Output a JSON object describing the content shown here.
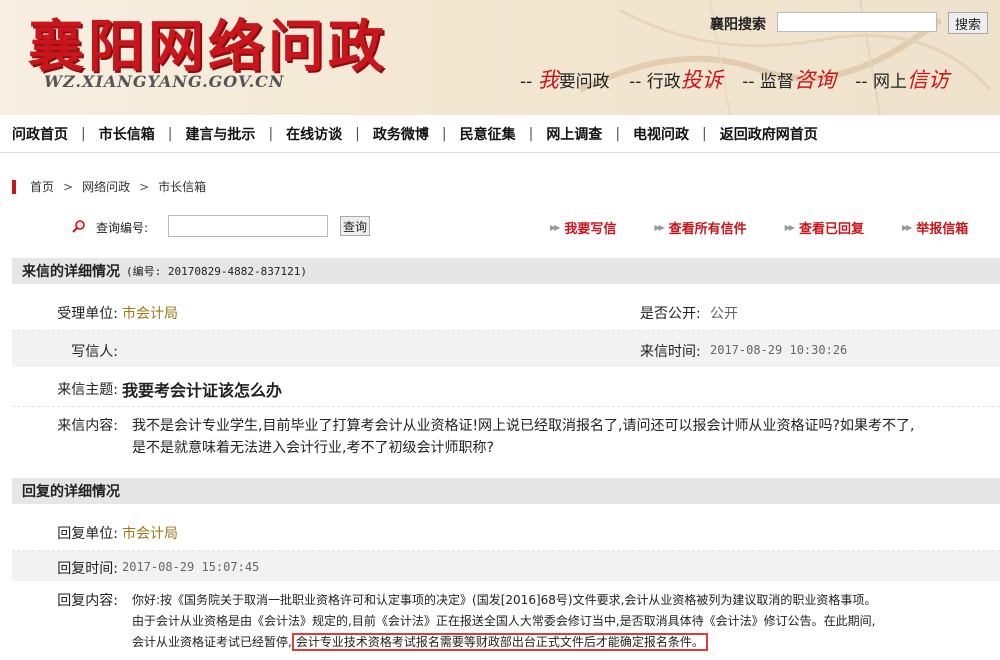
{
  "header": {
    "logo_title": "襄阳网络问政",
    "logo_url": "WZ.XIANGYANG.GOV.CN",
    "search_label": "襄阳搜索",
    "search_button": "搜索",
    "slogans": [
      {
        "prefix": "--",
        "hl": "我",
        "rest": "要问政"
      },
      {
        "prefix": "-- 行政",
        "hl": "投诉",
        "rest": ""
      },
      {
        "prefix": "-- 监督",
        "hl": "咨询",
        "rest": ""
      },
      {
        "prefix": "-- 网上",
        "hl": "信访",
        "rest": ""
      }
    ]
  },
  "nav": [
    "问政首页",
    "市长信箱",
    "建言与批示",
    "在线访谈",
    "政务微博",
    "民意征集",
    "网上调查",
    "电视问政",
    "返回政府网首页"
  ],
  "breadcrumb": [
    "首页",
    "网络问政",
    "市长信箱"
  ],
  "query": {
    "label": "查询编号:",
    "button": "查询",
    "links": [
      "我要写信",
      "查看所有信件",
      "查看已回复",
      "举报信箱"
    ]
  },
  "letter": {
    "section_title": "来信的详细情况",
    "section_id": "(编号: 20170829-4882-837121)",
    "unit_label": "受理单位:",
    "unit_value": "市会计局",
    "public_label": "是否公开:",
    "public_value": "公开",
    "writer_label": "写信人:",
    "writer_value": "",
    "time_label": "来信时间:",
    "time_value": "2017-08-29 10:30:26",
    "subject_label": "来信主题:",
    "subject_value": "我要考会计证该怎么办",
    "content_label": "来信内容:",
    "content_line1": "我不是会计专业学生,目前毕业了打算考会计从业资格证!网上说已经取消报名了,请问还可以报会计师从业资格证吗?如果考不了,",
    "content_line2": "是不是就意味着无法进入会计行业,考不了初级会计师职称?"
  },
  "reply": {
    "section_title": "回复的详细情况",
    "unit_label": "回复单位:",
    "unit_value": "市会计局",
    "time_label": "回复时间:",
    "time_value": "2017-08-29 15:07:45",
    "content_label": "回复内容:",
    "line1": "你好:按《国务院关于取消一批职业资格许可和认定事项的决定》(国发[2016]68号)文件要求,会计从业资格被列为建议取消的职业资格事项。",
    "line2": "由于会计从业资格是由《会计法》规定的,目前《会计法》正在报送全国人大常委会修订当中,是否取消具体待《会计法》修订公告。在此期间,",
    "line3_pre": "会计从业资格证考试已经暂停,",
    "line3_highlight": "会计专业技术资格考试报名需要等财政部出台正式文件后才能确定报名条件。"
  },
  "colors": {
    "brand_red": "#c8161d",
    "gold": "#9a7b18",
    "highlight_box": "#e23a3a"
  }
}
